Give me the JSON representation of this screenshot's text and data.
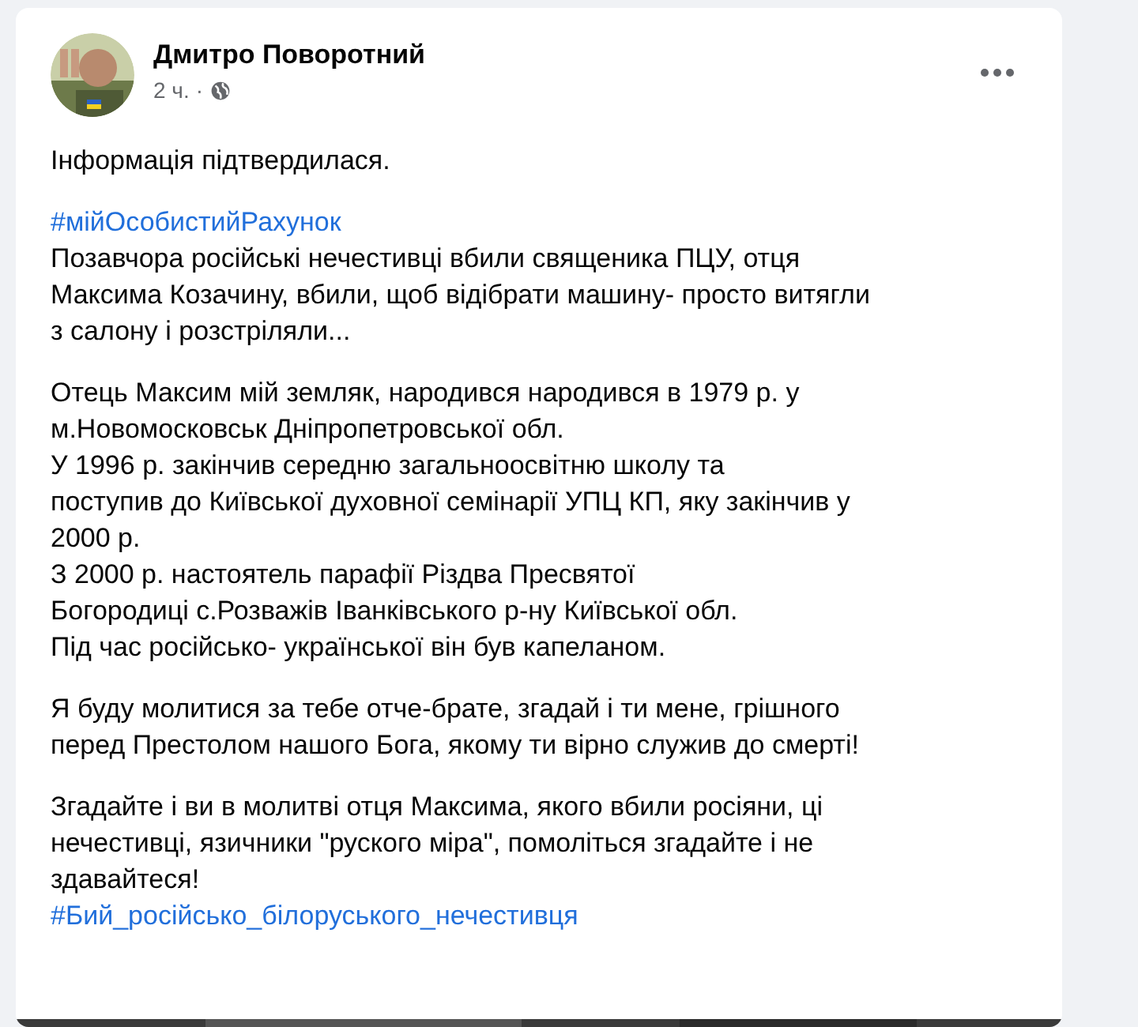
{
  "post": {
    "author": "Дмитро Поворотний",
    "time": "2 ч.",
    "separator": "·",
    "paragraphs": [
      {
        "lines": [
          {
            "kind": "text",
            "text": "Інформація підтвердилася."
          }
        ]
      },
      {
        "lines": [
          {
            "kind": "hashtag",
            "text": "#мійОсобистийРахунок"
          },
          {
            "kind": "text",
            "text": "Позавчора російські нечестивці вбили священика ПЦУ, отця"
          },
          {
            "kind": "text",
            "text": "Максима Козачину, вбили, щоб відібрати машину- просто витягли"
          },
          {
            "kind": "text",
            "text": "з салону і розстріляли..."
          }
        ]
      },
      {
        "lines": [
          {
            "kind": "text",
            "text": "Отець Максим мій земляк, народився народився в 1979 р. у"
          },
          {
            "kind": "text",
            "text": "м.Новомосковськ Дніпропетровської обл."
          },
          {
            "kind": "text",
            "text": "У 1996 р. закінчив середню загальноосвітню школу та"
          },
          {
            "kind": "text",
            "text": "поступив до Київської духовної семінарії УПЦ КП, яку закінчив у"
          },
          {
            "kind": "text",
            "text": "2000 р."
          },
          {
            "kind": "text",
            "text": "З 2000 р. настоятель парафії Різдва Пресвятої"
          },
          {
            "kind": "text",
            "text": "Богородиці с.Розважів Іванківського р-ну Київської обл."
          },
          {
            "kind": "text",
            "text": "Під час російсько- української він був капеланом."
          }
        ]
      },
      {
        "lines": [
          {
            "kind": "text",
            "text": "Я буду молитися за тебе отче-брате, згадай і ти мене, грішного"
          },
          {
            "kind": "text",
            "text": "перед Престолом нашого Бога, якому ти вірно служив до смерті!"
          }
        ]
      },
      {
        "lines": [
          {
            "kind": "text",
            "text": "Згадайте і ви в молитві отця Максима, якого вбили росіяни, ці"
          },
          {
            "kind": "text",
            "text": "нечестивці, язичники \"руского міра\", помоліться згадайте і не"
          },
          {
            "kind": "text",
            "text": "здавайтеся!"
          },
          {
            "kind": "hashtag",
            "text": "#Бий_російсько_білоруського_нечестивця"
          }
        ]
      }
    ]
  }
}
